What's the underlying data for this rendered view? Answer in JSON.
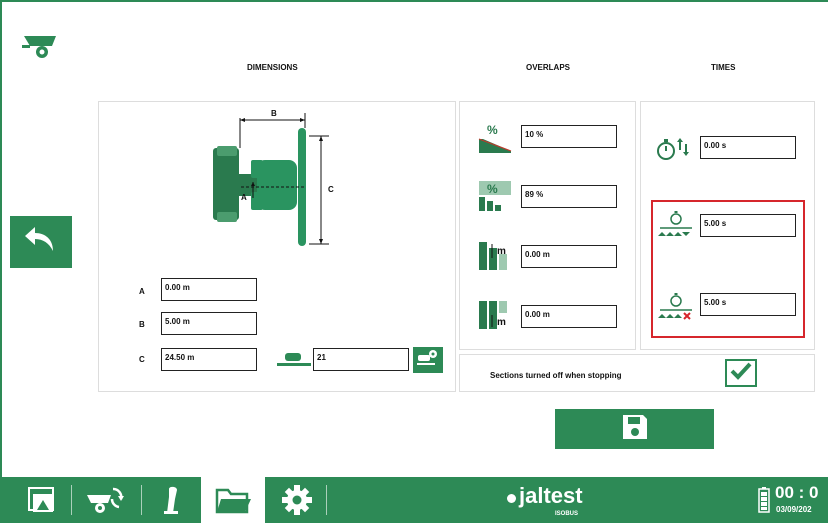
{
  "headers": {
    "dimensions": "DIMENSIONS",
    "overlaps": "OVERLAPS",
    "times": "TIMES"
  },
  "diagram": {
    "label_a": "A",
    "label_b": "B",
    "label_c": "C"
  },
  "dimensions": {
    "rows": [
      {
        "label": "A",
        "value": "0.00  m"
      },
      {
        "label": "B",
        "value": "5.00  m"
      },
      {
        "label": "C",
        "value": "24.50 m"
      }
    ],
    "sections_value": "21"
  },
  "overlaps": {
    "percent_symbol": "%",
    "m_symbol": "m",
    "values": [
      "10  %",
      "89  %",
      "0.00  m",
      "0.00  m"
    ]
  },
  "times": {
    "values": [
      "0.00 s",
      "5.00 s",
      "5.00 s"
    ]
  },
  "sections_off": {
    "label": "Sections turned off when stopping",
    "checked": true
  },
  "bottom_bar": {
    "brand": "jaltest",
    "brand_sub": "ISOBUS",
    "time": "00 : 0",
    "date": "03/09/202"
  },
  "colors": {
    "accent": "#2d8a56",
    "highlight": "#d6262c"
  },
  "icons": [
    "trailer-icon",
    "back-arrow-icon",
    "save-icon",
    "stopwatch-icon",
    "checkmark-icon",
    "folder-icon",
    "gear-icon",
    "joystick-icon",
    "battery-icon"
  ]
}
